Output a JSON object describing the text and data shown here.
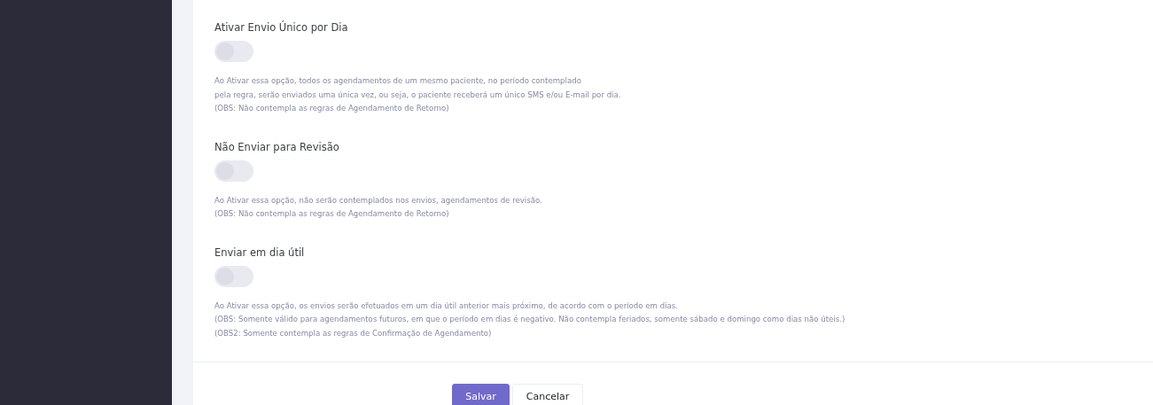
{
  "settings": [
    {
      "title": "Ativar Envio Único por Dia",
      "on": false,
      "description": [
        "Ao Ativar essa opção, todos os agendamentos de um mesmo paciente, no período contemplado",
        "pela regra, serão enviados uma única vez, ou seja, o paciente receberá um único SMS e/ou E-mail por dia.",
        "(OBS: Não contempla as regras de Agendamento de Retorno)"
      ]
    },
    {
      "title": "Não Enviar para Revisão",
      "on": false,
      "description": [
        "Ao Ativar essa opção, não serão contemplados nos envios, agendamentos de revisão.",
        "(OBS: Não contempla as regras de Agendamento de Retorno)"
      ]
    },
    {
      "title": "Enviar em dia útil",
      "on": false,
      "description": [
        "Ao Ativar essa opção, os envios serão efetuados em um dia útil anterior mais próximo, de acordo com o período em dias.",
        "(OBS: Somente válido para agendamentos futuros, em que o período em dias é negativo. Não contempla feriados, somente sábado e domingo como dias não úteis.)",
        "(OBS2: Somente contempla as regras de Confirmação de Agendamento)"
      ]
    }
  ],
  "buttons": [
    {
      "label": "Salvar",
      "kind": "primary"
    },
    {
      "label": "Cancelar",
      "kind": "secondary"
    }
  ]
}
